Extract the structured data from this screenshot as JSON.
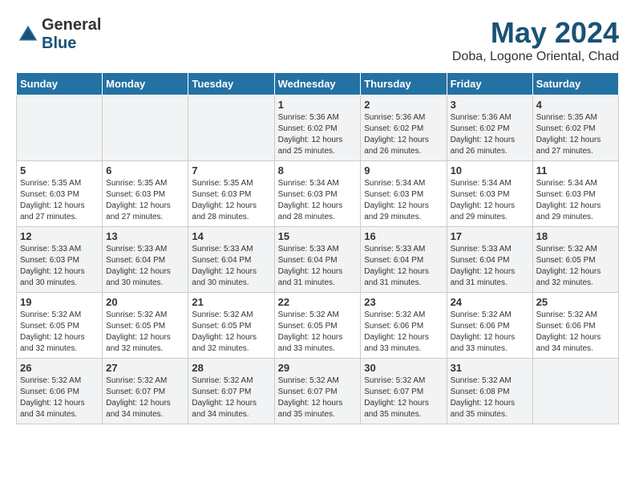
{
  "header": {
    "logo_general": "General",
    "logo_blue": "Blue",
    "month_year": "May 2024",
    "location": "Doba, Logone Oriental, Chad"
  },
  "days_of_week": [
    "Sunday",
    "Monday",
    "Tuesday",
    "Wednesday",
    "Thursday",
    "Friday",
    "Saturday"
  ],
  "weeks": [
    [
      {
        "day": "",
        "info": ""
      },
      {
        "day": "",
        "info": ""
      },
      {
        "day": "",
        "info": ""
      },
      {
        "day": "1",
        "info": "Sunrise: 5:36 AM\nSunset: 6:02 PM\nDaylight: 12 hours\nand 25 minutes."
      },
      {
        "day": "2",
        "info": "Sunrise: 5:36 AM\nSunset: 6:02 PM\nDaylight: 12 hours\nand 26 minutes."
      },
      {
        "day": "3",
        "info": "Sunrise: 5:36 AM\nSunset: 6:02 PM\nDaylight: 12 hours\nand 26 minutes."
      },
      {
        "day": "4",
        "info": "Sunrise: 5:35 AM\nSunset: 6:02 PM\nDaylight: 12 hours\nand 27 minutes."
      }
    ],
    [
      {
        "day": "5",
        "info": "Sunrise: 5:35 AM\nSunset: 6:03 PM\nDaylight: 12 hours\nand 27 minutes."
      },
      {
        "day": "6",
        "info": "Sunrise: 5:35 AM\nSunset: 6:03 PM\nDaylight: 12 hours\nand 27 minutes."
      },
      {
        "day": "7",
        "info": "Sunrise: 5:35 AM\nSunset: 6:03 PM\nDaylight: 12 hours\nand 28 minutes."
      },
      {
        "day": "8",
        "info": "Sunrise: 5:34 AM\nSunset: 6:03 PM\nDaylight: 12 hours\nand 28 minutes."
      },
      {
        "day": "9",
        "info": "Sunrise: 5:34 AM\nSunset: 6:03 PM\nDaylight: 12 hours\nand 29 minutes."
      },
      {
        "day": "10",
        "info": "Sunrise: 5:34 AM\nSunset: 6:03 PM\nDaylight: 12 hours\nand 29 minutes."
      },
      {
        "day": "11",
        "info": "Sunrise: 5:34 AM\nSunset: 6:03 PM\nDaylight: 12 hours\nand 29 minutes."
      }
    ],
    [
      {
        "day": "12",
        "info": "Sunrise: 5:33 AM\nSunset: 6:03 PM\nDaylight: 12 hours\nand 30 minutes."
      },
      {
        "day": "13",
        "info": "Sunrise: 5:33 AM\nSunset: 6:04 PM\nDaylight: 12 hours\nand 30 minutes."
      },
      {
        "day": "14",
        "info": "Sunrise: 5:33 AM\nSunset: 6:04 PM\nDaylight: 12 hours\nand 30 minutes."
      },
      {
        "day": "15",
        "info": "Sunrise: 5:33 AM\nSunset: 6:04 PM\nDaylight: 12 hours\nand 31 minutes."
      },
      {
        "day": "16",
        "info": "Sunrise: 5:33 AM\nSunset: 6:04 PM\nDaylight: 12 hours\nand 31 minutes."
      },
      {
        "day": "17",
        "info": "Sunrise: 5:33 AM\nSunset: 6:04 PM\nDaylight: 12 hours\nand 31 minutes."
      },
      {
        "day": "18",
        "info": "Sunrise: 5:32 AM\nSunset: 6:05 PM\nDaylight: 12 hours\nand 32 minutes."
      }
    ],
    [
      {
        "day": "19",
        "info": "Sunrise: 5:32 AM\nSunset: 6:05 PM\nDaylight: 12 hours\nand 32 minutes."
      },
      {
        "day": "20",
        "info": "Sunrise: 5:32 AM\nSunset: 6:05 PM\nDaylight: 12 hours\nand 32 minutes."
      },
      {
        "day": "21",
        "info": "Sunrise: 5:32 AM\nSunset: 6:05 PM\nDaylight: 12 hours\nand 32 minutes."
      },
      {
        "day": "22",
        "info": "Sunrise: 5:32 AM\nSunset: 6:05 PM\nDaylight: 12 hours\nand 33 minutes."
      },
      {
        "day": "23",
        "info": "Sunrise: 5:32 AM\nSunset: 6:06 PM\nDaylight: 12 hours\nand 33 minutes."
      },
      {
        "day": "24",
        "info": "Sunrise: 5:32 AM\nSunset: 6:06 PM\nDaylight: 12 hours\nand 33 minutes."
      },
      {
        "day": "25",
        "info": "Sunrise: 5:32 AM\nSunset: 6:06 PM\nDaylight: 12 hours\nand 34 minutes."
      }
    ],
    [
      {
        "day": "26",
        "info": "Sunrise: 5:32 AM\nSunset: 6:06 PM\nDaylight: 12 hours\nand 34 minutes."
      },
      {
        "day": "27",
        "info": "Sunrise: 5:32 AM\nSunset: 6:07 PM\nDaylight: 12 hours\nand 34 minutes."
      },
      {
        "day": "28",
        "info": "Sunrise: 5:32 AM\nSunset: 6:07 PM\nDaylight: 12 hours\nand 34 minutes."
      },
      {
        "day": "29",
        "info": "Sunrise: 5:32 AM\nSunset: 6:07 PM\nDaylight: 12 hours\nand 35 minutes."
      },
      {
        "day": "30",
        "info": "Sunrise: 5:32 AM\nSunset: 6:07 PM\nDaylight: 12 hours\nand 35 minutes."
      },
      {
        "day": "31",
        "info": "Sunrise: 5:32 AM\nSunset: 6:08 PM\nDaylight: 12 hours\nand 35 minutes."
      },
      {
        "day": "",
        "info": ""
      }
    ]
  ]
}
